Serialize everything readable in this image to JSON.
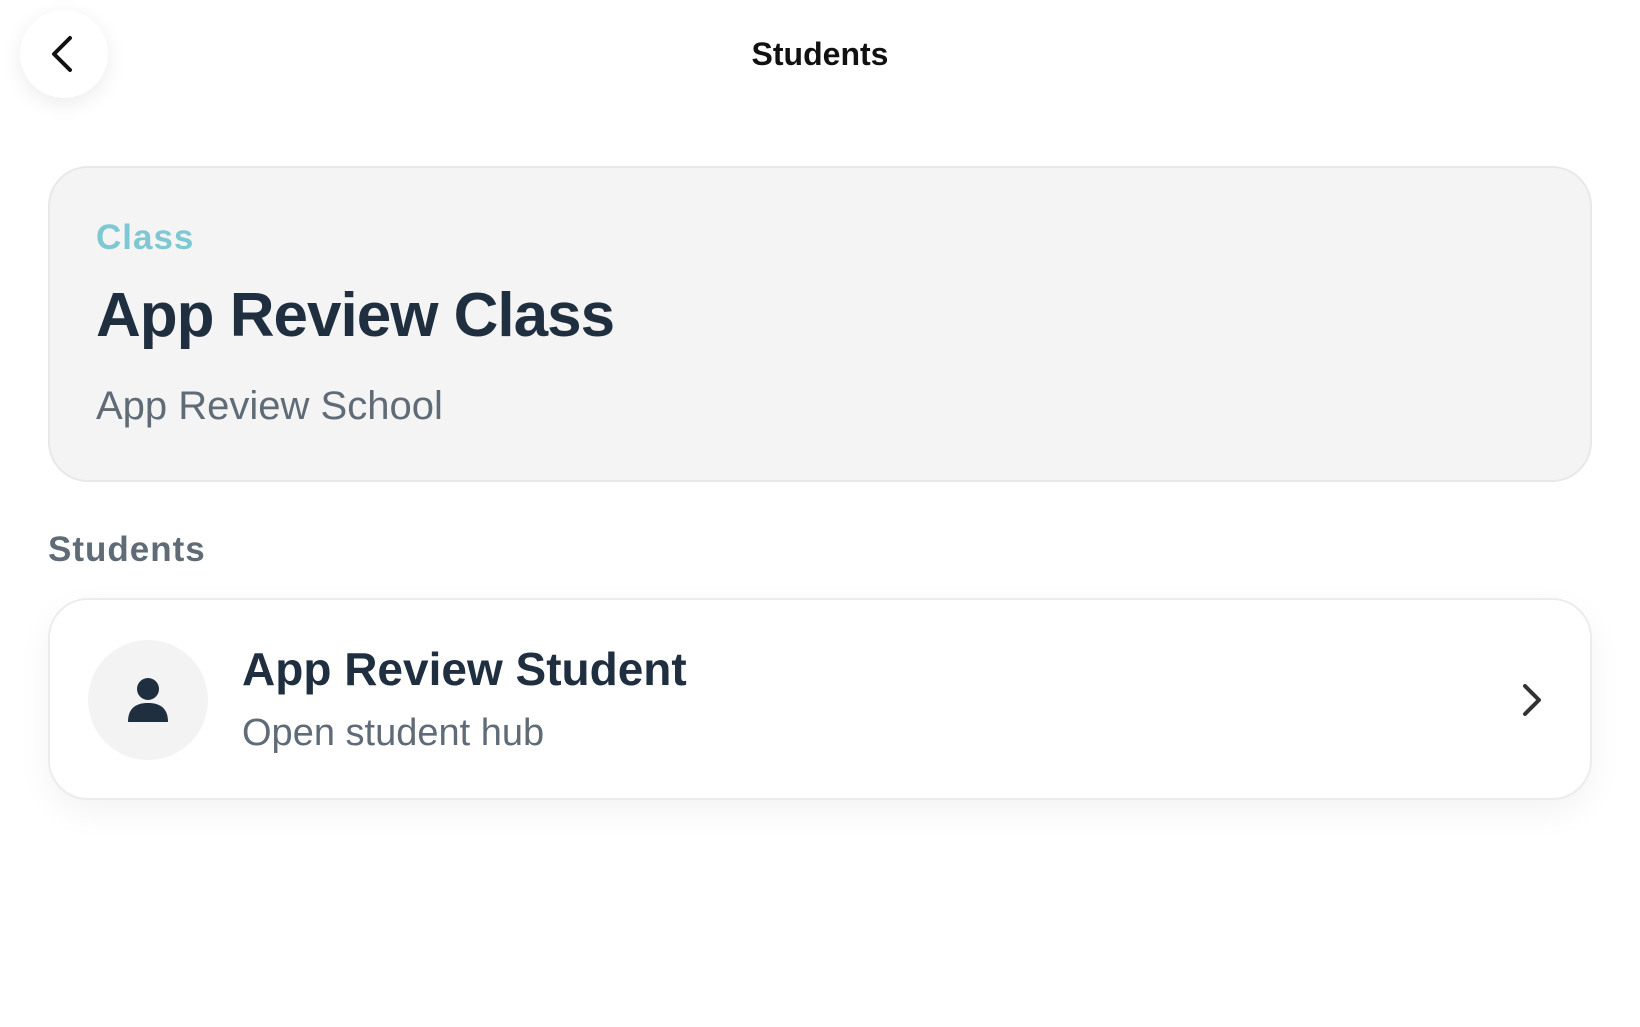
{
  "nav": {
    "title": "Students",
    "back_icon": "chevron-left-icon"
  },
  "class_card": {
    "label": "Class",
    "name": "App Review Class",
    "school": "App Review School"
  },
  "students_section": {
    "heading": "Students",
    "items": [
      {
        "name": "App Review Student",
        "subtitle": "Open student hub",
        "avatar_icon": "person-icon",
        "trailing_icon": "chevron-right-icon"
      }
    ]
  },
  "colors": {
    "accent": "#7ec8d3",
    "primary_text": "#1f2f40",
    "secondary_text": "#5f6b76",
    "card_background": "#f4f4f4"
  }
}
